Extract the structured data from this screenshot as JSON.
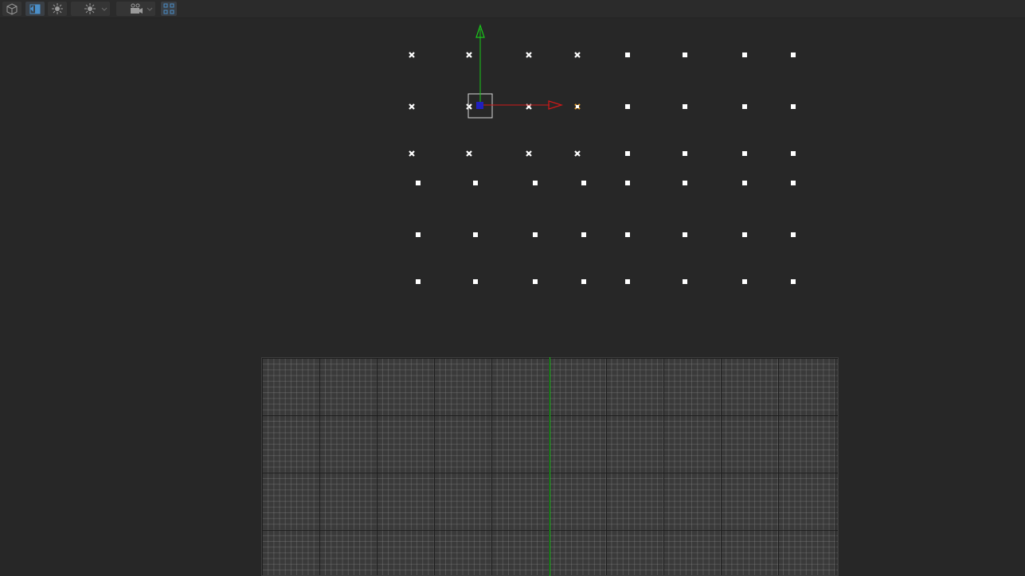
{
  "toolbar": {
    "buttons": [
      {
        "name": "scene-view-button",
        "icon": "cube-icon",
        "active": false
      },
      {
        "name": "shading-mode-button",
        "icon": "half-shaded-icon",
        "active": true
      },
      {
        "name": "lighting-button",
        "icon": "sun-icon",
        "active": false
      },
      {
        "name": "lighting-dropdown",
        "icon": "sun-icon",
        "active": false
      },
      {
        "name": "camera-dropdown",
        "icon": "camera-icon",
        "active": false
      },
      {
        "name": "grid-view-button",
        "icon": "grid-icon",
        "active": true
      }
    ]
  },
  "colors": {
    "background": "#272727",
    "toolbar": "#2b2b2b",
    "axis_x": "#d01818",
    "axis_y": "#19c919",
    "gizmo_center": "#2020c0",
    "selected_point": "#e8a030",
    "points": "#ffffff"
  },
  "scene": {
    "gizmo": {
      "x_axis": "red",
      "y_axis": "green",
      "center": "blue"
    },
    "selected_point_count": 1
  }
}
